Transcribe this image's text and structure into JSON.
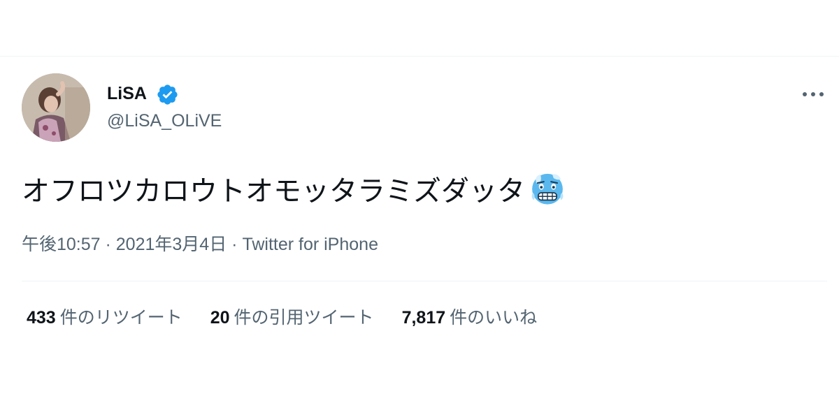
{
  "user": {
    "display_name": "LiSA",
    "handle": "@LiSA_OLiVE",
    "verified": true,
    "verified_color": "#1d9bf0"
  },
  "tweet": {
    "text": "オフロツカロウトオモッタラミズダッタ",
    "emoji": "cold-face-emoji"
  },
  "meta": {
    "time": "午後10:57",
    "separator": " · ",
    "date": "2021年3月4日",
    "source": "Twitter for iPhone"
  },
  "stats": {
    "retweets": {
      "count": "433",
      "label": "件のリツイート"
    },
    "quotes": {
      "count": "20",
      "label": "件の引用ツイート"
    },
    "likes": {
      "count": "7,817",
      "label": "件のいいね"
    }
  },
  "colors": {
    "text_primary": "#0f1419",
    "text_secondary": "#536471",
    "divider": "#eff3f4"
  }
}
